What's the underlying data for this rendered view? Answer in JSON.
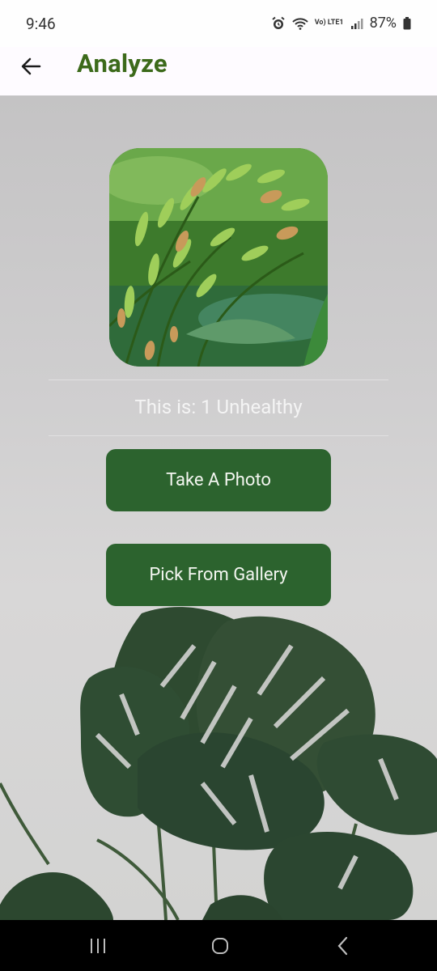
{
  "status_bar": {
    "time": "9:46",
    "network": "Vo) LTE1",
    "battery": "87%"
  },
  "app_bar": {
    "title": "Analyze",
    "back_icon": "arrow-left-icon",
    "title_color": "#3c6a1a"
  },
  "main": {
    "result_text": "This is: 1 Unhealthy",
    "take_photo_label": "Take A Photo",
    "pick_gallery_label": "Pick From Gallery",
    "button_color": "#2c632e"
  },
  "nav_bar": {
    "recents_icon": "recents-icon",
    "home_icon": "home-icon",
    "back_icon": "back-icon"
  }
}
